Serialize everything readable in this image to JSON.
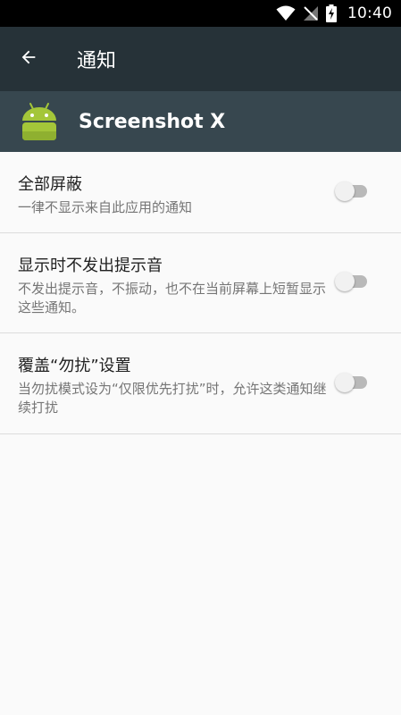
{
  "status_bar": {
    "time": "10:40",
    "icons": [
      "wifi-icon",
      "signal-off-icon",
      "battery-charging-icon"
    ]
  },
  "app_bar": {
    "title": "通知",
    "back_icon": "arrow-left-icon"
  },
  "app_header": {
    "icon": "android-icon",
    "app_name": "Screenshot X",
    "icon_color": "#a4c639"
  },
  "settings": [
    {
      "title": "全部屏蔽",
      "summary": "一律不显示来自此应用的通知",
      "switch_on": false
    },
    {
      "title": "显示时不发出提示音",
      "summary": "不发出提示音，不振动，也不在当前屏幕上短暂显示这些通知。",
      "switch_on": false
    },
    {
      "title": "覆盖“勿扰”设置",
      "summary": "当勿扰模式设为“仅限优先打扰”时，允许这类通知继续打扰",
      "switch_on": false
    }
  ],
  "colors": {
    "status_bar": "#000000",
    "app_bar": "#263238",
    "app_header": "#37474f",
    "background": "#fafafa",
    "switch_track_off": "#b9b9b9",
    "switch_thumb_off": "#f1f1f1"
  }
}
